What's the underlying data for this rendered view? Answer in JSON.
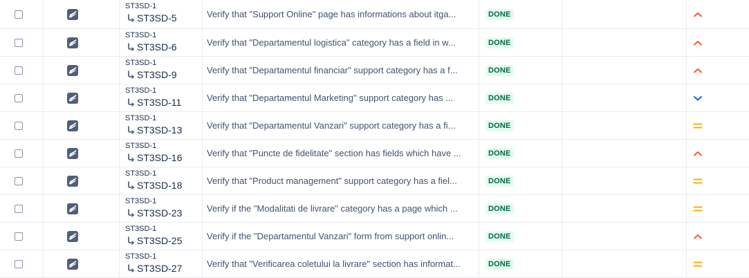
{
  "colors": {
    "high": "#ff5630",
    "medium": "#ffab00",
    "low": "#0065ff",
    "done_bg": "#e3fcef",
    "done_text": "#006644"
  },
  "issues": [
    {
      "parent": "ST3SD-1",
      "key": "ST3SD-5",
      "summary": "Verify that \"Support Online\" page has informations about itga...",
      "status": "DONE",
      "priority": "chevron-up-icon",
      "type_icon": "test-issue-icon"
    },
    {
      "parent": "ST3SD-1",
      "key": "ST3SD-6",
      "summary": "Verify that \"Departamentul logistica\" category has a field in w...",
      "status": "DONE",
      "priority": "chevron-up-icon",
      "type_icon": "test-issue-icon"
    },
    {
      "parent": "ST3SD-1",
      "key": "ST3SD-9",
      "summary": "Verify that \"Departamentul financiar\" support category has a f...",
      "status": "DONE",
      "priority": "chevron-up-icon",
      "type_icon": "test-issue-icon"
    },
    {
      "parent": "ST3SD-1",
      "key": "ST3SD-11",
      "summary": "Verify that \"Departamentul Marketing\" support category has ...",
      "status": "DONE",
      "priority": "chevron-down-icon",
      "type_icon": "test-issue-icon"
    },
    {
      "parent": "ST3SD-1",
      "key": "ST3SD-13",
      "summary": "Verify that \"Departamentul Vanzari\" support category has a fi...",
      "status": "DONE",
      "priority": "equals-icon",
      "type_icon": "test-issue-icon"
    },
    {
      "parent": "ST3SD-1",
      "key": "ST3SD-16",
      "summary": "Verify that \"Puncte de fidelitate\" section has fields which have ...",
      "status": "DONE",
      "priority": "chevron-up-icon",
      "type_icon": "test-issue-icon"
    },
    {
      "parent": "ST3SD-1",
      "key": "ST3SD-18",
      "summary": "Verify that \"Product management\" support category has a fiel...",
      "status": "DONE",
      "priority": "equals-icon",
      "type_icon": "test-issue-icon"
    },
    {
      "parent": "ST3SD-1",
      "key": "ST3SD-23",
      "summary": "Verify if the \"Modalitati de livrare\" category has a page which ...",
      "status": "DONE",
      "priority": "equals-icon",
      "type_icon": "test-issue-icon"
    },
    {
      "parent": "ST3SD-1",
      "key": "ST3SD-25",
      "summary": "Verify if the \"Departamentul Vanzari\" form from support onlin...",
      "status": "DONE",
      "priority": "chevron-up-icon",
      "type_icon": "test-issue-icon"
    },
    {
      "parent": "ST3SD-1",
      "key": "ST3SD-27",
      "summary": "Verify that \"Verificarea coletului la livrare\" section has informat...",
      "status": "DONE",
      "priority": "equals-icon",
      "type_icon": "test-issue-icon"
    }
  ]
}
